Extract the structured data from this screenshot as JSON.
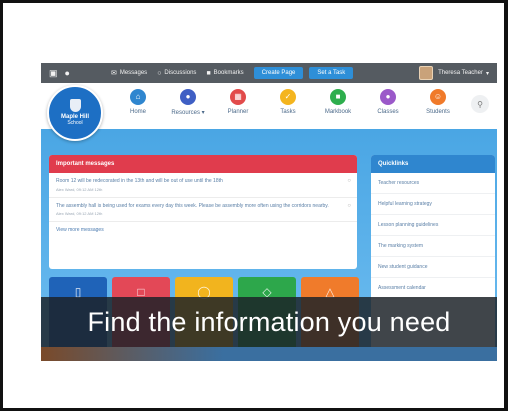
{
  "topbar": {
    "camera_icon": "video-camera-icon",
    "pin_icon": "pin-icon",
    "links": [
      "Messages",
      "Discussions",
      "Bookmarks"
    ],
    "buttons": [
      "Create Page",
      "Set a Task"
    ],
    "user": "Theresa Teacher"
  },
  "logo": {
    "name": "Maple Hill",
    "sub": "School"
  },
  "nav": [
    {
      "label": "Home",
      "color": "#2f86cf",
      "icon": "home-icon"
    },
    {
      "label": "Resources",
      "color": "#3f5fc4",
      "icon": "globe-icon"
    },
    {
      "label": "Planner",
      "color": "#e24b4b",
      "icon": "planner-icon"
    },
    {
      "label": "Tasks",
      "color": "#f4b51f",
      "icon": "tasks-icon"
    },
    {
      "label": "Markbook",
      "color": "#2eae4d",
      "icon": "markbook-icon"
    },
    {
      "label": "Classes",
      "color": "#9b59c9",
      "icon": "classes-icon"
    },
    {
      "label": "Students",
      "color": "#f07a2a",
      "icon": "students-icon"
    }
  ],
  "messages": {
    "title": "Important messages",
    "items": [
      {
        "text": "Room 12 will be redecorated in the 13th and will be out of use until the 18th",
        "meta": "Alex Ward, 09:12 AM 12th"
      },
      {
        "text": "The assembly hall is being used for exams every day this week. Please be assembly more often using the corridors nearby.",
        "meta": "Alex Ward, 09:12 AM 12th"
      }
    ],
    "view_more": "View more messages"
  },
  "quicklinks": {
    "title": "Quicklinks",
    "items": [
      "Teacher resources",
      "Helpful learning strategy",
      "Lesson planning guidelines",
      "The marking system",
      "New student guidance",
      "Assessment calendar"
    ]
  },
  "tiles": [
    {
      "color": "#1f63b8",
      "icon": "tile-icon-1"
    },
    {
      "color": "#e34857",
      "icon": "tile-icon-2"
    },
    {
      "color": "#f2b41e",
      "icon": "tile-icon-3"
    },
    {
      "color": "#2da74b",
      "icon": "tile-icon-4"
    },
    {
      "color": "#f07b2b",
      "icon": "tile-icon-5"
    }
  ],
  "caption": "Find the information you need"
}
